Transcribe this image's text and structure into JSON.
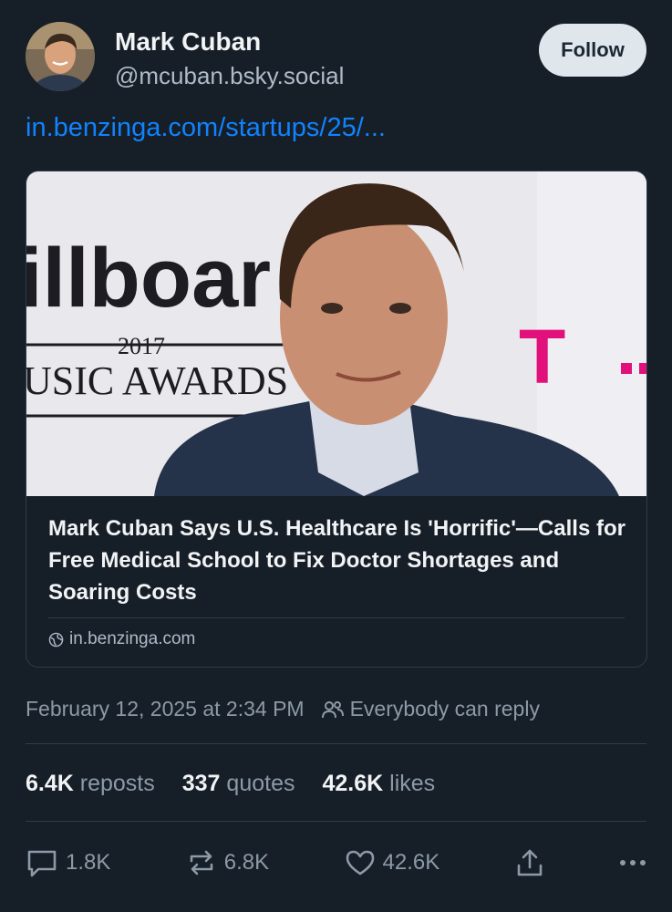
{
  "post": {
    "author_name": "Mark Cuban",
    "author_handle": "@mcuban.bsky.social",
    "follow_label": "Follow",
    "link_text": "in.benzinga.com/startups/25/...",
    "embed": {
      "title": "Mark Cuban Says U.S. Healthcare Is 'Horrific'—Calls for Free Medical School to Fix Doctor Shortages and Soaring Costs",
      "domain": "in.benzinga.com",
      "image_text": {
        "logo": "illboar",
        "year": "2017",
        "event": "USIC AWARDS",
        "sponsor": "T"
      }
    },
    "timestamp": "February 12, 2025 at 2:34 PM",
    "reply_setting": "Everybody can reply",
    "stats": {
      "reposts_count": "6.4K",
      "reposts_label": "reposts",
      "quotes_count": "337",
      "quotes_label": "quotes",
      "likes_count": "42.6K",
      "likes_label": "likes"
    },
    "actions": {
      "reply_count": "1.8K",
      "repost_count": "6.8K",
      "like_count": "42.6K"
    }
  },
  "colors": {
    "background": "#161e27",
    "link": "#1083fe",
    "muted": "#8c9aa8",
    "border": "#2e3d4c",
    "follow_button": "#dfe6ec"
  },
  "icons": [
    "globe-icon",
    "people-icon",
    "comment-icon",
    "repost-icon",
    "heart-icon",
    "share-icon",
    "more-icon"
  ]
}
